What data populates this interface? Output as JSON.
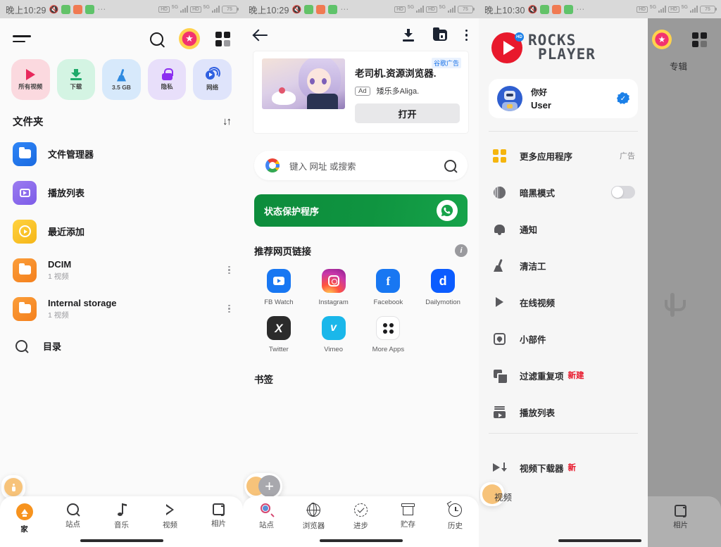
{
  "statusbar": {
    "time_left": "晚上10:29",
    "time_mid": "晚上10:29",
    "time_right": "晚上10:30",
    "battery": "75",
    "network": "5G",
    "hd": "HD"
  },
  "pane_left": {
    "header": {
      "menu_icon": "hamburger-icon",
      "search_icon": "search-icon",
      "star_icon": "star-badge-icon",
      "grid_icon": "grid-apps-icon"
    },
    "tiles": [
      {
        "label": "所有视频",
        "icon": "play-icon",
        "theme": "red"
      },
      {
        "label": "下载",
        "icon": "download-icon",
        "theme": "green"
      },
      {
        "label": "3.5 GB",
        "icon": "broom-icon",
        "theme": "blue"
      },
      {
        "label": "隐私",
        "icon": "lock-icon",
        "theme": "purple"
      },
      {
        "label": "网络",
        "icon": "network-play-icon",
        "theme": "indigo"
      }
    ],
    "section_title": "文件夹",
    "sort_icon": "sort-arrows-icon",
    "folders": [
      {
        "name": "文件管理器",
        "sub": "",
        "icon": "folder-icon",
        "color": "blue",
        "menu": false
      },
      {
        "name": "播放列表",
        "sub": "",
        "icon": "playlist-icon",
        "color": "purple",
        "menu": false
      },
      {
        "name": "最近添加",
        "sub": "",
        "icon": "recent-icon",
        "color": "yellow",
        "menu": false
      },
      {
        "name": "DCIM",
        "sub": "1 视频",
        "icon": "folder-icon",
        "color": "orange",
        "menu": true
      },
      {
        "name": "Internal storage",
        "sub": "1 视频",
        "icon": "folder-icon",
        "color": "orange",
        "menu": true
      }
    ],
    "directory_label": "目录",
    "bottom_nav": [
      {
        "label": "家",
        "icon": "home-icon",
        "active": true
      },
      {
        "label": "站点",
        "icon": "search-icon",
        "active": false
      },
      {
        "label": "音乐",
        "icon": "music-note-icon",
        "active": false
      },
      {
        "label": "视频",
        "icon": "play-triangle-icon",
        "active": false
      },
      {
        "label": "相片",
        "icon": "photos-icon",
        "active": false
      }
    ]
  },
  "pane_mid": {
    "header": {
      "back_icon": "arrow-back-icon",
      "download_icon": "download-icon",
      "private_folder_icon": "lock-folder-icon",
      "overflow_icon": "more-vertical-icon"
    },
    "ad": {
      "tag": "谷歌广告",
      "title": "老司机.资源浏览器.",
      "badge": "Ad",
      "advertiser": "矮乐多Aliga.",
      "cta": "打开"
    },
    "search": {
      "placeholder": "键入 网址 或搜索",
      "google_icon": "google-logo-icon",
      "search_icon": "search-icon"
    },
    "banner": {
      "label": "状态保护程序",
      "icon": "whatsapp-icon",
      "color": "#0f9440"
    },
    "links_section": {
      "title": "推荐网页链接",
      "info_icon": "info-icon"
    },
    "apps": [
      {
        "label": "FB Watch",
        "icon": "fb-watch-icon"
      },
      {
        "label": "Instagram",
        "icon": "instagram-icon"
      },
      {
        "label": "Facebook",
        "icon": "facebook-icon"
      },
      {
        "label": "Dailymotion",
        "icon": "dailymotion-icon"
      },
      {
        "label": "Twitter",
        "icon": "twitter-x-icon"
      },
      {
        "label": "Vimeo",
        "icon": "vimeo-icon"
      },
      {
        "label": "More Apps",
        "icon": "more-apps-icon"
      }
    ],
    "bookmarks_title": "书签",
    "bottom_nav": [
      {
        "label": "站点",
        "icon": "site-search-icon"
      },
      {
        "label": "浏览器",
        "icon": "globe-icon"
      },
      {
        "label": "进步",
        "icon": "progress-check-icon"
      },
      {
        "label": "贮存",
        "icon": "storage-icon"
      },
      {
        "label": "历史",
        "icon": "history-icon"
      }
    ]
  },
  "pane_right": {
    "logo": {
      "line1": "ROCKS",
      "line2": "PLAYER",
      "hd_badge": "HD"
    },
    "user": {
      "greeting": "你好",
      "name": "User",
      "verified_icon": "verified-badge-icon"
    },
    "menu": [
      {
        "label": "更多应用程序",
        "icon": "apps-grid-icon",
        "tag": "广告",
        "new": false,
        "toggle": false
      },
      {
        "label": "暗黑模式",
        "icon": "dark-mode-icon",
        "tag": "",
        "new": false,
        "toggle": true
      },
      {
        "label": "通知",
        "icon": "bell-icon",
        "tag": "",
        "new": false,
        "toggle": false
      },
      {
        "label": "清洁工",
        "icon": "broom-icon",
        "tag": "",
        "new": false,
        "toggle": false
      },
      {
        "label": "在线视频",
        "icon": "play-icon",
        "tag": "",
        "new": false,
        "toggle": false
      },
      {
        "label": "小部件",
        "icon": "widget-icon",
        "tag": "",
        "new": false,
        "toggle": false
      },
      {
        "label": "过滤重复项",
        "icon": "duplicate-icon",
        "tag": "",
        "new": "新建",
        "toggle": false
      },
      {
        "label": "播放列表",
        "icon": "playlist-icon",
        "tag": "",
        "new": false,
        "toggle": false
      },
      {
        "label": "视频下载器",
        "icon": "video-download-icon",
        "tag": "",
        "new": "新",
        "toggle": false
      }
    ],
    "shade_label": "视频",
    "background": {
      "tab_label": "专辑",
      "star_icon": "star-badge-icon",
      "grid_icon": "grid-apps-icon",
      "nav_label": "相片",
      "nav_icon": "photos-icon"
    }
  }
}
